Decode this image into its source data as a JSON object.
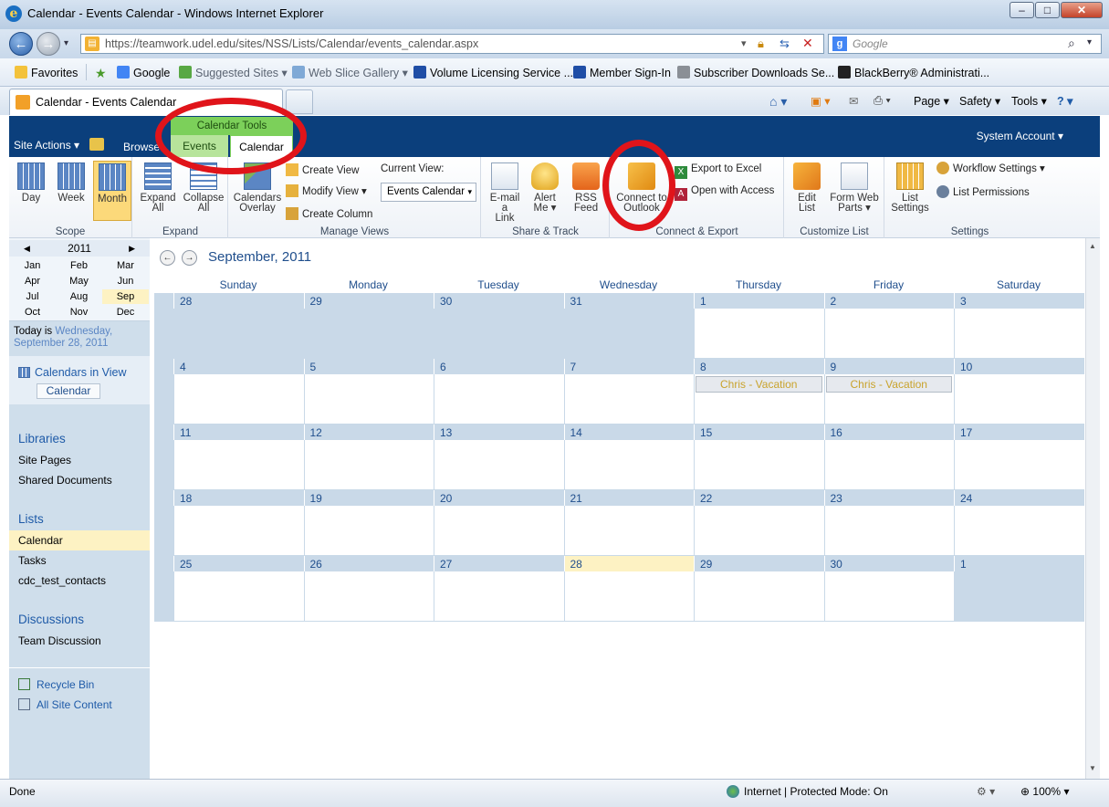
{
  "window": {
    "title": "Calendar - Events Calendar - Windows Internet Explorer",
    "min": "–",
    "max": "□",
    "close": "✕"
  },
  "address": {
    "url": "https://teamwork.udel.edu/sites/NSS/Lists/Calendar/events_calendar.aspx",
    "search_placeholder": "Google"
  },
  "favorites": {
    "label": "Favorites",
    "items": [
      "Google",
      "Suggested Sites ▾",
      "Web Slice Gallery ▾",
      "Volume Licensing Service ...",
      "Member Sign-In",
      "Subscriber Downloads  Se...",
      "BlackBerry® Administrati..."
    ]
  },
  "tab": {
    "title": "Calendar - Events Calendar",
    "commands": [
      "Page ▾",
      "Safety ▾",
      "Tools ▾",
      "? ▾"
    ]
  },
  "sp": {
    "site_actions": "Site Actions ▾",
    "browse": "Browse",
    "tools_label": "Calendar Tools",
    "tab_events": "Events",
    "tab_calendar": "Calendar",
    "system_account": "System Account ▾"
  },
  "ribbon": {
    "scope": {
      "label": "Scope",
      "day": "Day",
      "week": "Week",
      "month": "Month"
    },
    "expand": {
      "label": "Expand",
      "expand_all_1": "Expand",
      "expand_all_2": "All",
      "collapse_all_1": "Collapse",
      "collapse_all_2": "All"
    },
    "manage": {
      "label": "Manage Views",
      "overlay_1": "Calendars",
      "overlay_2": "Overlay",
      "create_view": "Create View",
      "modify_view": "Modify View ▾",
      "create_column": "Create Column",
      "current_view": "Current View:",
      "view_value": "Events Calendar"
    },
    "share": {
      "label": "Share & Track",
      "email_1": "E-mail a",
      "email_2": "Link",
      "alert_1": "Alert",
      "alert_2": "Me ▾",
      "rss_1": "RSS",
      "rss_2": "Feed"
    },
    "connect": {
      "label": "Connect & Export",
      "outlook_1": "Connect to",
      "outlook_2": "Outlook",
      "excel": "Export to Excel",
      "access": "Open with Access"
    },
    "customize": {
      "label": "Customize List",
      "edit_1": "Edit",
      "edit_2": "List",
      "form_1": "Form Web",
      "form_2": "Parts ▾"
    },
    "settings": {
      "label": "Settings",
      "list_1": "List",
      "list_2": "Settings",
      "workflow": "Workflow Settings ▾",
      "permissions": "List Permissions"
    }
  },
  "mini_cal": {
    "year": "2011",
    "months": [
      "Jan",
      "Feb",
      "Mar",
      "Apr",
      "May",
      "Jun",
      "Jul",
      "Aug",
      "Sep",
      "Oct",
      "Nov",
      "Dec"
    ],
    "today_prefix": "Today is ",
    "today_1": "Wednesday,",
    "today_2": "September 28, 2011"
  },
  "nav": {
    "calendars_in_view": "Calendars in View",
    "calendar_chip": "Calendar",
    "libraries": "Libraries",
    "site_pages": "Site Pages",
    "shared_documents": "Shared Documents",
    "lists": "Lists",
    "list_calendar": "Calendar",
    "list_tasks": "Tasks",
    "list_contacts": "cdc_test_contacts",
    "discussions": "Discussions",
    "team_discussion": "Team Discussion",
    "recycle_bin": "Recycle Bin",
    "all_site_content": "All Site Content"
  },
  "calendar": {
    "title": "September, 2011",
    "days": [
      "Sunday",
      "Monday",
      "Tuesday",
      "Wednesday",
      "Thursday",
      "Friday",
      "Saturday"
    ],
    "weeks": [
      [
        "28",
        "29",
        "30",
        "31",
        "1",
        "2",
        "3"
      ],
      [
        "4",
        "5",
        "6",
        "7",
        "8",
        "9",
        "10"
      ],
      [
        "11",
        "12",
        "13",
        "14",
        "15",
        "16",
        "17"
      ],
      [
        "18",
        "19",
        "20",
        "21",
        "22",
        "23",
        "24"
      ],
      [
        "25",
        "26",
        "27",
        "28",
        "29",
        "30",
        "1"
      ]
    ],
    "event_label": "Chris - Vacation"
  },
  "status": {
    "left": "Done",
    "zone": "Internet | Protected Mode: On",
    "zoom": "100%"
  },
  "colors": {
    "sp_bar": "#0b3f7c",
    "tools_green": "#7cd05a",
    "highlight": "#e0141a"
  }
}
